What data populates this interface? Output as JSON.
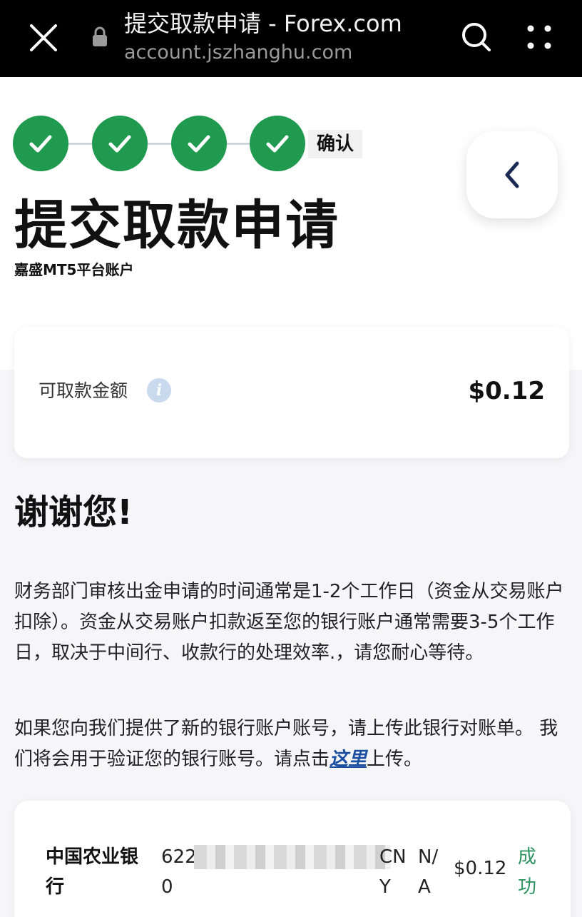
{
  "browser": {
    "title": "提交取款申请 - Forex.com",
    "url": "account.jszhanghu.com"
  },
  "stepper": {
    "current_label": "确认",
    "accent": "#1f9a4f"
  },
  "page": {
    "title": "提交取款申请",
    "account_name": "嘉盛MT5平台账户"
  },
  "balance": {
    "label": "可取款金额",
    "value": "$0.12"
  },
  "confirmation": {
    "title": "谢谢您!",
    "para1": "财务部门审核出金申请的时间通常是1-2个工作日（资金从交易账户扣除）。资金从交易账户扣款返至您的银行账户通常需要3-5个工作日，取决于中间行、收款行的处理效率.，请您耐心等待。",
    "para2_before": "如果您向我们提供了新的银行账户账号，请上传此银行对账单。 我们将会用于验证您的银行账号。请点击",
    "para2_link": "这里",
    "para2_after": "上传。"
  },
  "transaction": {
    "bank": "中国农业银行",
    "account_prefix": "622",
    "account_suffix": "0",
    "currency": "CNY",
    "reference": "N/A",
    "amount": "$0.12",
    "status": "成功",
    "status_color": "#2f9460"
  }
}
